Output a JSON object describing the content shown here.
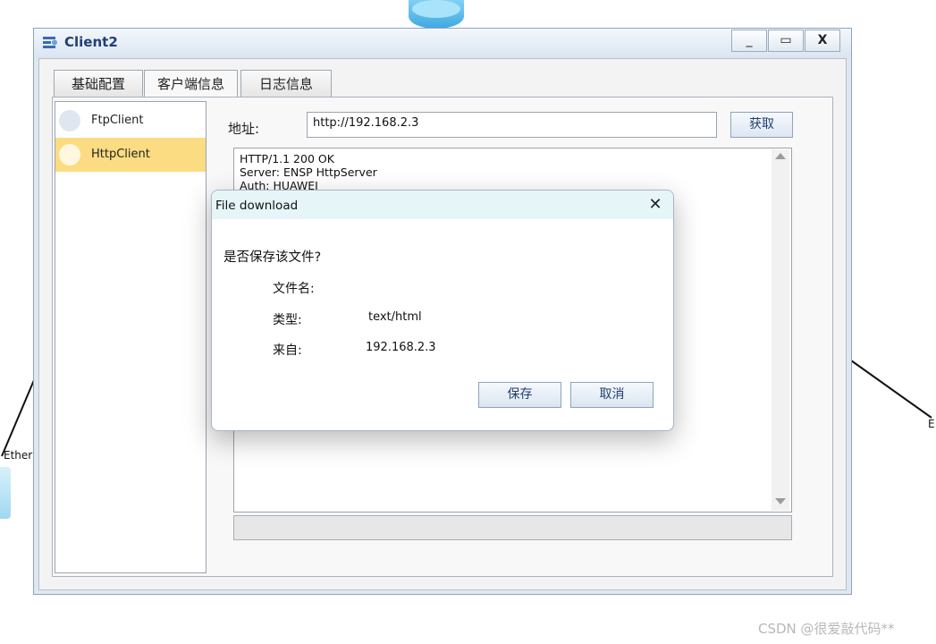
{
  "background": {
    "ether_label_left": "Ether",
    "ether_label_right": "E"
  },
  "window": {
    "title": "Client2",
    "controls": {
      "minimize": "_",
      "maximize": "▭",
      "close": "X"
    }
  },
  "tabs": [
    {
      "label": "基础配置"
    },
    {
      "label": "客户端信息"
    },
    {
      "label": "日志信息"
    }
  ],
  "client_list": [
    {
      "label": "FtpClient"
    },
    {
      "label": "HttpClient"
    }
  ],
  "address": {
    "label": "地址:",
    "value": "http://192.168.2.3",
    "fetch_label": "获取"
  },
  "response": {
    "text": "HTTP/1.1 200 OK\nServer: ENSP HttpServer\nAuth: HUAWEI"
  },
  "dialog": {
    "title": "File download",
    "close": "✕",
    "question": "是否保存该文件?",
    "filename_label": "文件名:",
    "type_label": "类型:",
    "type_value": "text/html",
    "from_label": "来自:",
    "from_value": "192.168.2.3",
    "save_label": "保存",
    "cancel_label": "取消"
  },
  "watermark": "CSDN @很爱敲代码**",
  "colors": {
    "accent": "#223f72",
    "selected_item": "#fcdc82",
    "dialog_title_bg": "#e6f5f8"
  }
}
